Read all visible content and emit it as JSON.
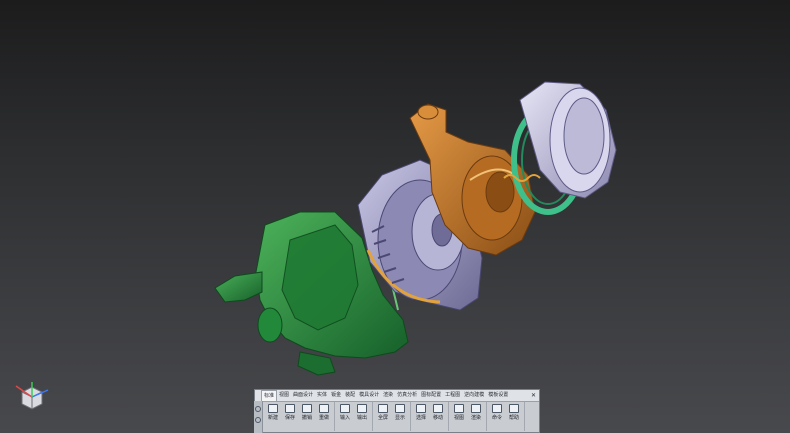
{
  "ribbon": {
    "tabs": [
      "标准",
      "视图",
      "曲面设计",
      "实体",
      "钣金",
      "装配",
      "模具设计",
      "渲染",
      "仿真分析",
      "图标配置",
      "工程图",
      "逆向建模",
      "模板设置"
    ],
    "buttons": [
      [
        "新建",
        "保存",
        "撤销",
        "重做"
      ],
      [
        "输入",
        "输出"
      ],
      [
        "全屏",
        "显示"
      ],
      [
        "选择",
        "移动"
      ],
      [
        "视图",
        "渲染"
      ],
      [
        "命令",
        "帮助"
      ]
    ],
    "close_label": "✕"
  },
  "colors": {
    "housing": "#2d8a3e",
    "impeller": "#9d9bc2",
    "volute": "#c07a2b",
    "cap": "#c6c3de",
    "seal_ring": "#3fbf8a",
    "coil": "#e3a23a"
  },
  "icons": [
    "view-cube-icon"
  ]
}
